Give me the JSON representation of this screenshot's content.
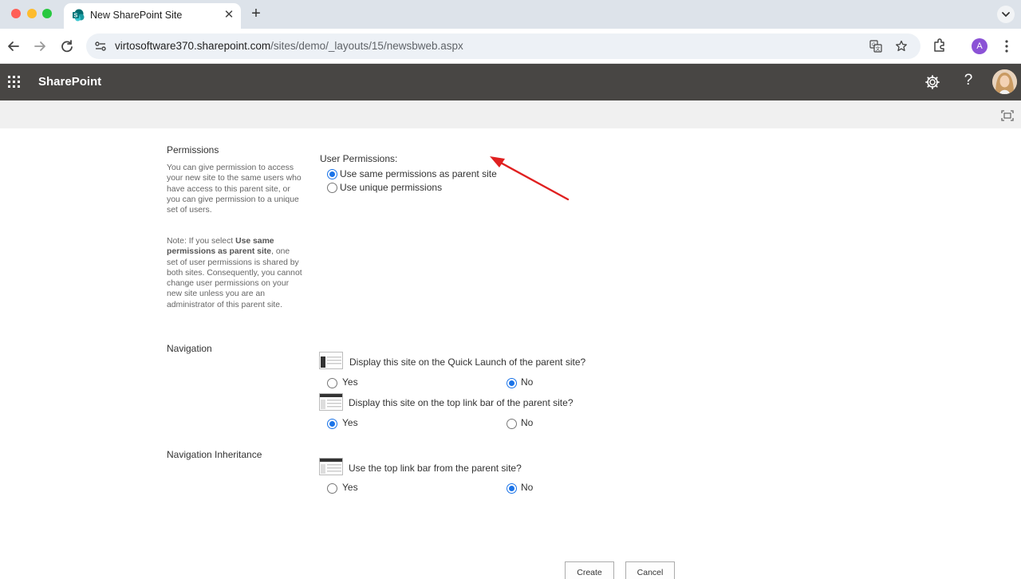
{
  "browser": {
    "tab_title": "New SharePoint Site",
    "tab_close": "✕",
    "new_tab": "+",
    "url_host": "virtosoftware370.sharepoint.com",
    "url_path": "/sites/demo/_layouts/15/newsbweb.aspx",
    "profile_initial": "A"
  },
  "suitebar": {
    "brand": "SharePoint",
    "help": "?"
  },
  "permissions": {
    "title": "Permissions",
    "desc": "You can give permission to access your new site to the same users who have access to this parent site, or you can give permission to a unique set of users.",
    "note_prefix": "Note: If you select ",
    "note_bold": "Use same permissions as parent site",
    "note_suffix": ", one set of user permissions is shared by both sites. Consequently, you cannot change user permissions on your new site unless you are an administrator of this parent site.",
    "field_label": "User Permissions:",
    "options": [
      {
        "label": "Use same permissions as parent site",
        "checked": true
      },
      {
        "label": "Use unique permissions",
        "checked": false
      }
    ]
  },
  "navigation": {
    "title": "Navigation",
    "quick_launch_question": "Display this site on the Quick Launch of the parent site?",
    "quick_launch_yes": "Yes",
    "quick_launch_no": "No",
    "top_link_question": "Display this site on the top link bar of the parent site?",
    "top_link_yes": "Yes",
    "top_link_no": "No"
  },
  "navigation_inheritance": {
    "title": "Navigation Inheritance",
    "question": "Use the top link bar from the parent site?",
    "yes": "Yes",
    "no": "No"
  },
  "actions": {
    "create": "Create",
    "cancel": "Cancel"
  },
  "colors": {
    "suitebar": "#484644",
    "accent": "#1a73e8",
    "annotation_arrow": "#e02020"
  }
}
